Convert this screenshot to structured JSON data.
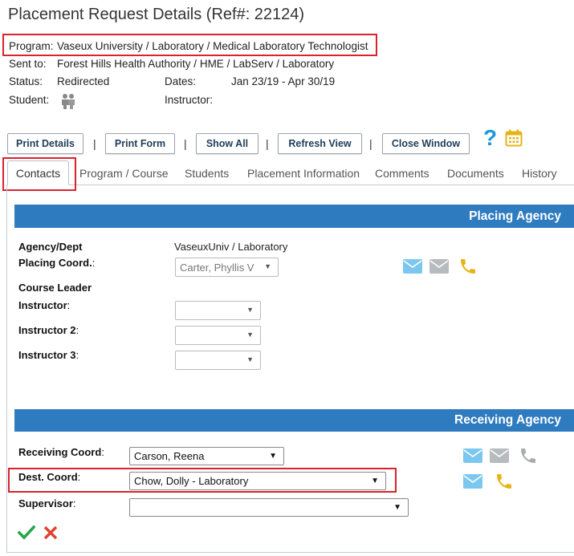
{
  "header": {
    "title": "Placement Request Details (Ref#: 22124)"
  },
  "info": {
    "program_label": "Program:",
    "program_value": "Vaseux University / Laboratory / Medical Laboratory Technologist",
    "sent_to_label": "Sent to:",
    "sent_to_value": "Forest Hills Health Authority / HME / LabServ / Laboratory",
    "status_label": "Status:",
    "status_value": "Redirected",
    "dates_label": "Dates:",
    "dates_value": "Jan 23/19 - Apr 30/19",
    "student_label": "Student:",
    "instructor_label": "Instructor:"
  },
  "toolbar": {
    "print_details": "Print Details",
    "print_form": "Print Form",
    "show_all": "Show All",
    "refresh_view": "Refresh View",
    "close_window": "Close Window",
    "separator": "|"
  },
  "tabs": [
    {
      "label": "Contacts",
      "active": true
    },
    {
      "label": "Program / Course"
    },
    {
      "label": "Students"
    },
    {
      "label": "Placement Information"
    },
    {
      "label": "Comments"
    },
    {
      "label": "Documents"
    },
    {
      "label": "History"
    }
  ],
  "placing": {
    "title": "Placing Agency",
    "agency_label": "Agency/Dept",
    "agency_value": "VaseuxUniv / Laboratory",
    "coord_label": "Placing Coord.",
    "coord_value": "Carter, Phyllis V",
    "course_leader_label": "Course Leader",
    "instructor_label": "Instructor",
    "instructor2_label": "Instructor 2",
    "instructor3_label": "Instructor 3",
    "instructor_value": "",
    "instructor2_value": "",
    "instructor3_value": ""
  },
  "receiving": {
    "title": "Receiving Agency",
    "coord_label": "Receiving Coord",
    "coord_value": "Carson, Reena",
    "dest_label": "Dest. Coord",
    "dest_value": "Chow, Dolly - Laboratory",
    "supervisor_label": "Supervisor",
    "supervisor_value": ""
  },
  "glyphs": {
    "colon": ":",
    "dropdown_arrow": "▼",
    "help": "?"
  },
  "colors": {
    "section_bar": "#2e7bbf",
    "highlight": "#d9232e",
    "email_blue": "#7cc7f0",
    "email_grey": "#b7bbbe",
    "phone_gold": "#e6b417",
    "help_teal": "#1d9ad6",
    "save_green": "#2aa54a",
    "cancel_red": "#e0432f"
  },
  "icons": [
    "student-icon",
    "help-icon",
    "calendar-icon",
    "email-icon",
    "phone-icon",
    "save-icon",
    "cancel-icon"
  ]
}
